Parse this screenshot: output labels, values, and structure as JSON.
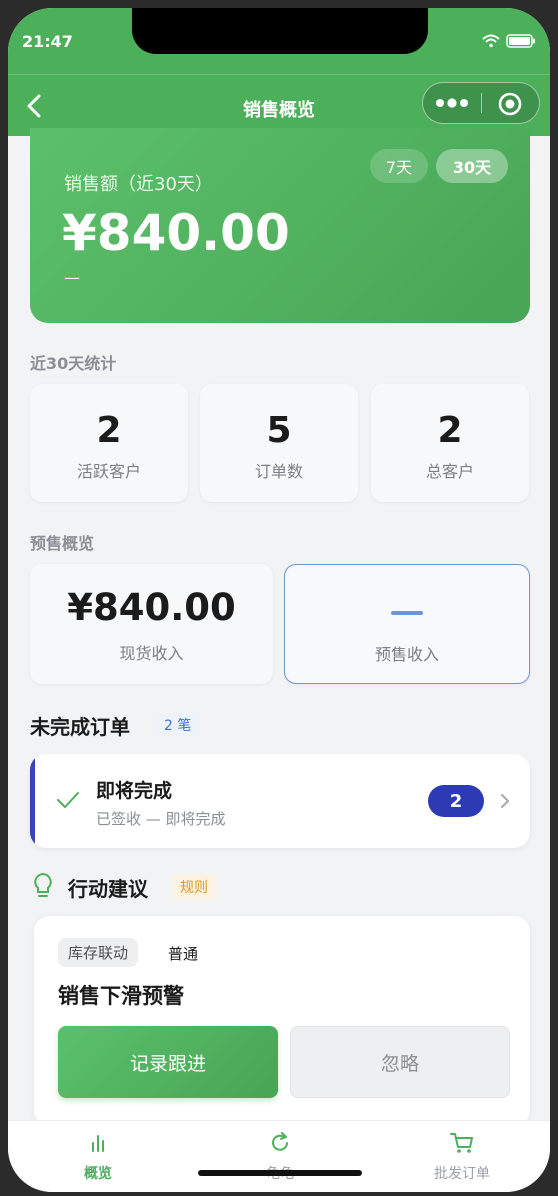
{
  "status": {
    "time": "21:47"
  },
  "nav": {
    "title": "销售概览"
  },
  "hero": {
    "label": "销售额（近30天）",
    "value": "¥840.00",
    "sub": "—",
    "ranges": [
      "7天",
      "30天"
    ],
    "selected_range": "30天"
  },
  "stats": {
    "title": "近30天统计",
    "items": [
      {
        "value": "2",
        "label": "活跃客户"
      },
      {
        "value": "5",
        "label": "订单数"
      },
      {
        "value": "2",
        "label": "总客户"
      }
    ]
  },
  "presale": {
    "title": "预售概览",
    "spot": {
      "value": "¥840.00",
      "label": "现货收入"
    },
    "pre": {
      "label": "预售收入"
    }
  },
  "pending": {
    "title": "未完成订单",
    "count_tag": "2 笔",
    "card": {
      "title": "即将完成",
      "subtitle": "已签收 — 即将完成",
      "badge": "2"
    }
  },
  "advice": {
    "title": "行动建议",
    "rule_tag": "规则",
    "card": {
      "tag": "库存联动",
      "level": "普通",
      "title": "销售下滑预警",
      "primary_label": "记录跟进",
      "secondary_label": "忽略"
    }
  },
  "tabbar": {
    "items": [
      {
        "label": "概览",
        "icon": "bar-chart-icon",
        "active": true
      },
      {
        "label": "龟龟",
        "icon": "refresh-icon",
        "active": false
      },
      {
        "label": "批发订单",
        "icon": "cart-icon",
        "active": false
      }
    ]
  },
  "colors": {
    "brand": "#4caf5a",
    "accent_blue": "#2c3bb3",
    "rule_orange": "#d99a2b"
  }
}
